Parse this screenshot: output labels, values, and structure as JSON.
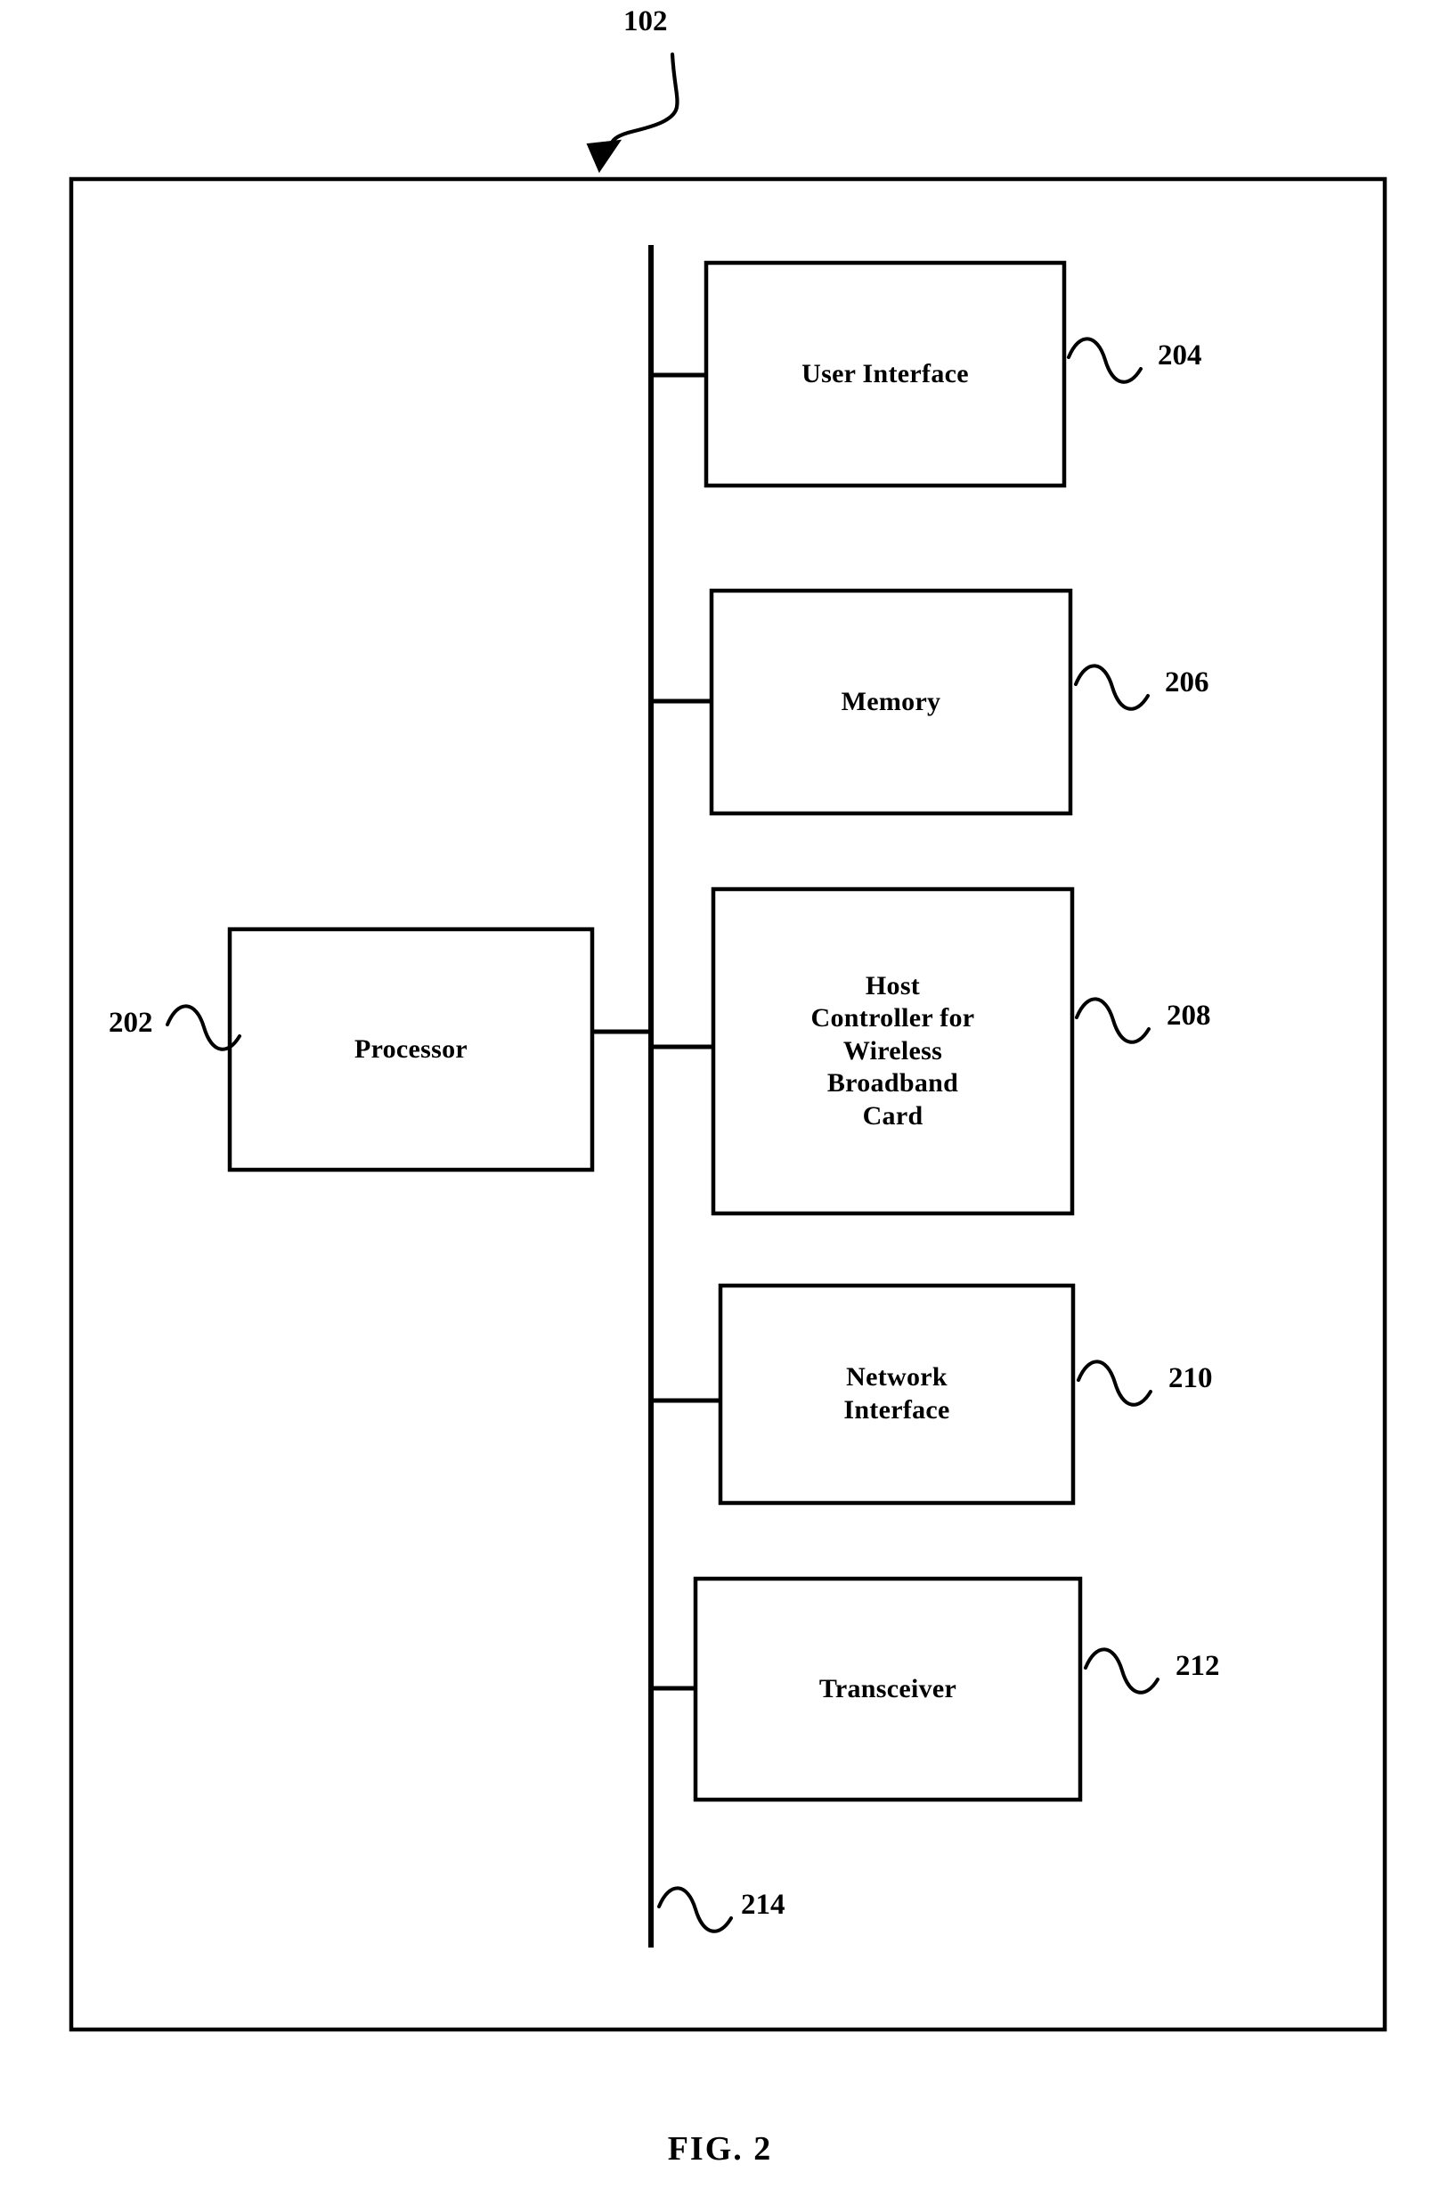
{
  "figure": {
    "caption": "FIG. 2",
    "top_reference": "102",
    "outer_box_name": "device-enclosure"
  },
  "blocks": [
    {
      "id": "user-interface",
      "lines": [
        "User Interface"
      ],
      "reference": "204"
    },
    {
      "id": "memory",
      "lines": [
        "Memory"
      ],
      "reference": "206"
    },
    {
      "id": "host-controller",
      "lines": [
        "Host",
        "Controller for",
        "Wireless",
        "Broadband",
        "Card"
      ],
      "reference": "208"
    },
    {
      "id": "network-interface",
      "lines": [
        "Network",
        "Interface"
      ],
      "reference": "210"
    },
    {
      "id": "transceiver",
      "lines": [
        "Transceiver"
      ],
      "reference": "212"
    },
    {
      "id": "processor",
      "lines": [
        "Processor"
      ],
      "reference": "202"
    }
  ],
  "bus": {
    "reference": "214"
  },
  "colors": {
    "ink": "#000000",
    "paper": "#ffffff"
  }
}
